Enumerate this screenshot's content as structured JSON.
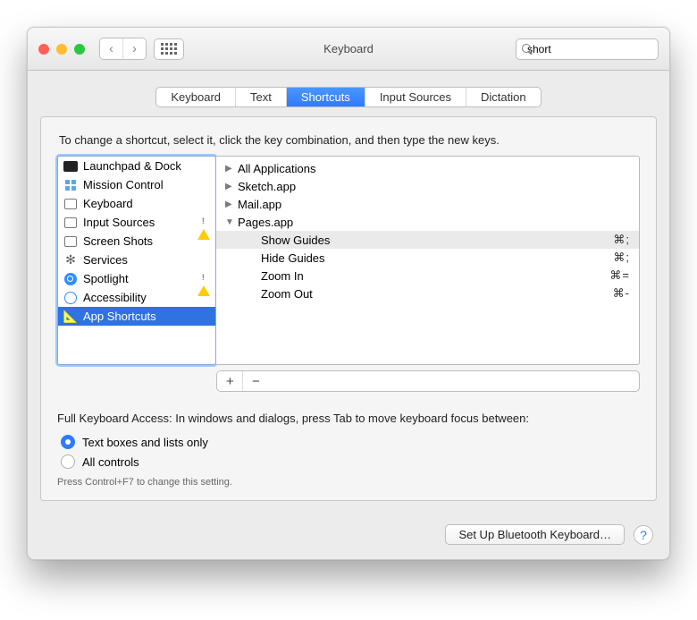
{
  "window": {
    "title": "Keyboard"
  },
  "search": {
    "value": "short",
    "placeholder": "Search"
  },
  "tabs": [
    {
      "label": "Keyboard",
      "active": false
    },
    {
      "label": "Text",
      "active": false
    },
    {
      "label": "Shortcuts",
      "active": true
    },
    {
      "label": "Input Sources",
      "active": false
    },
    {
      "label": "Dictation",
      "active": false
    }
  ],
  "instruction": "To change a shortcut, select it, click the key combination, and then type the new keys.",
  "categories": [
    {
      "label": "Launchpad & Dock",
      "icon": "launchpad",
      "warn": false,
      "selected": false
    },
    {
      "label": "Mission Control",
      "icon": "mission",
      "warn": false,
      "selected": false
    },
    {
      "label": "Keyboard",
      "icon": "keyboard",
      "warn": false,
      "selected": false
    },
    {
      "label": "Input Sources",
      "icon": "input",
      "warn": true,
      "selected": false
    },
    {
      "label": "Screen Shots",
      "icon": "screenshot",
      "warn": false,
      "selected": false
    },
    {
      "label": "Services",
      "icon": "services",
      "warn": false,
      "selected": false
    },
    {
      "label": "Spotlight",
      "icon": "spotlight",
      "warn": true,
      "selected": false
    },
    {
      "label": "Accessibility",
      "icon": "accessibility",
      "warn": false,
      "selected": false
    },
    {
      "label": "App Shortcuts",
      "icon": "app",
      "warn": false,
      "selected": true
    }
  ],
  "shortcuts_tree": [
    {
      "label": "All Applications",
      "expanded": false,
      "indent": 0,
      "shortcut": "",
      "selected": false
    },
    {
      "label": "Sketch.app",
      "expanded": false,
      "indent": 0,
      "shortcut": "",
      "selected": false
    },
    {
      "label": "Mail.app",
      "expanded": false,
      "indent": 0,
      "shortcut": "",
      "selected": false
    },
    {
      "label": "Pages.app",
      "expanded": true,
      "indent": 0,
      "shortcut": "",
      "selected": false
    },
    {
      "label": "Show Guides",
      "expanded": null,
      "indent": 1,
      "shortcut": "⌘;",
      "selected": true
    },
    {
      "label": "Hide Guides",
      "expanded": null,
      "indent": 1,
      "shortcut": "⌘;",
      "selected": false
    },
    {
      "label": "Zoom In",
      "expanded": null,
      "indent": 1,
      "shortcut": "⌘=",
      "selected": false
    },
    {
      "label": "Zoom Out",
      "expanded": null,
      "indent": 1,
      "shortcut": "⌘-",
      "selected": false
    }
  ],
  "footer": {
    "fk_label": "Full Keyboard Access: In windows and dialogs, press Tab to move keyboard focus between:",
    "radio1": "Text boxes and lists only",
    "radio2": "All controls",
    "radio_selected": 0,
    "hint": "Press Control+F7 to change this setting.",
    "bt_button": "Set Up Bluetooth Keyboard…"
  },
  "buttons": {
    "add": "+",
    "remove": "−",
    "help": "?"
  }
}
